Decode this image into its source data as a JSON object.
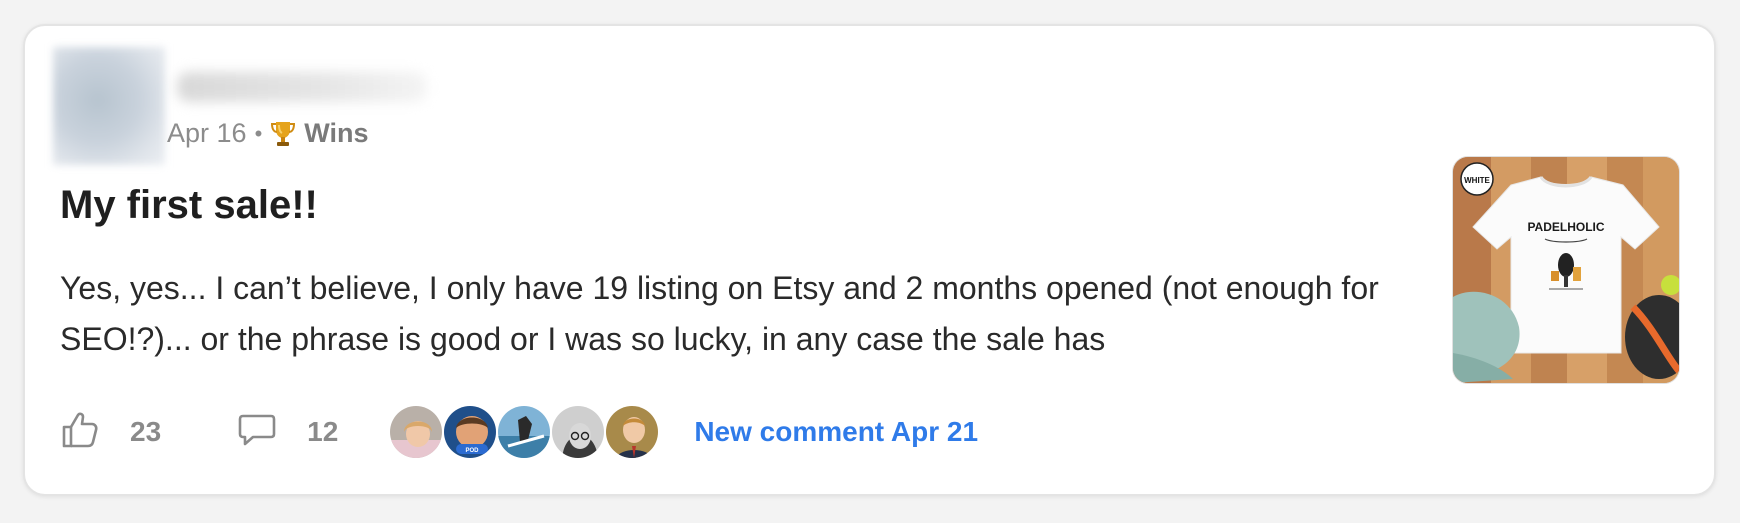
{
  "post": {
    "date": "Apr 16",
    "separator": "•",
    "category_icon": "trophy-icon",
    "category": "Wins",
    "title": "My first sale!!",
    "body": "Yes, yes... I can’t believe, I only have 19 listing on Etsy and 2 months opened (not enough for SEO!?)... or the phrase is good or I was so lucky, in any case the sale has",
    "thumbnail": {
      "badge": "WHITE",
      "brand": "PADELHOLIC"
    }
  },
  "footer": {
    "like_icon": "thumbs-up-icon",
    "likes": "23",
    "comment_icon": "comment-icon",
    "comments": "12",
    "new_comment": "New comment Apr 21"
  },
  "colors": {
    "accent": "#2f7be9",
    "muted": "#8a8a8a",
    "text": "#1f1f1f"
  }
}
